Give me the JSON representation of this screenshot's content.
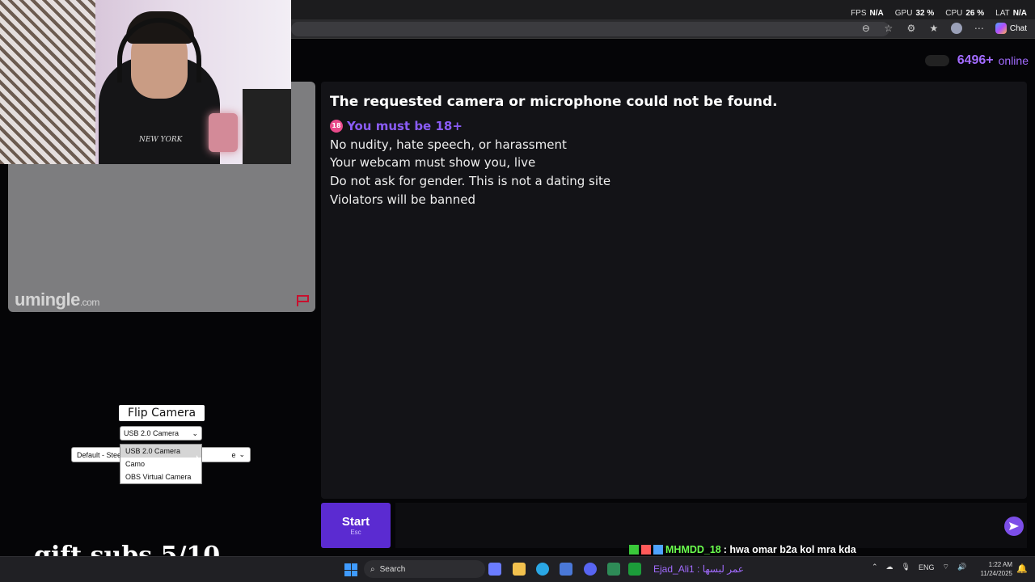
{
  "browser": {
    "stats": [
      {
        "label": "FPS",
        "value": "N/A"
      },
      {
        "label": "GPU",
        "value": "32 %"
      },
      {
        "label": "CPU",
        "value": "26 %"
      },
      {
        "label": "LAT",
        "value": "N/A"
      }
    ],
    "copilot_label": "Chat"
  },
  "site": {
    "online_count": "6496+",
    "online_label": "online",
    "logo_main": "umingle",
    "logo_suffix": ".com"
  },
  "webcam": {
    "shirt_text": "NEW YORK"
  },
  "chat": {
    "error": "The requested camera or microphone could not be found.",
    "age_icon_text": "18",
    "rules": [
      "You must be 18+",
      "No nudity, hate speech, or harassment",
      "Your webcam must show you, live",
      "Do not ask for gender. This is not a dating site",
      "Violators will be banned"
    ]
  },
  "controls": {
    "flip_label": "Flip Camera",
    "camera_selected": "USB 2.0 Camera",
    "camera_options": [
      "USB 2.0 Camera",
      "Camo",
      "OBS Virtual Camera"
    ],
    "mic_selected_left": "Default - Stee",
    "mic_selected_right": "e",
    "start_label": "Start",
    "start_hint": "Esc"
  },
  "stream": {
    "gift_subs": "gift subs 5/10",
    "chat_user": "MHMDD_18",
    "chat_msg": ": hwa omar b2a kol mra kda",
    "taskbar_overlay": "Ejad_Ali1 : عمر لبسها"
  },
  "taskbar": {
    "search_label": "Search",
    "lang": "ENG",
    "time": "1:22 AM",
    "date": "11/24/2025"
  }
}
